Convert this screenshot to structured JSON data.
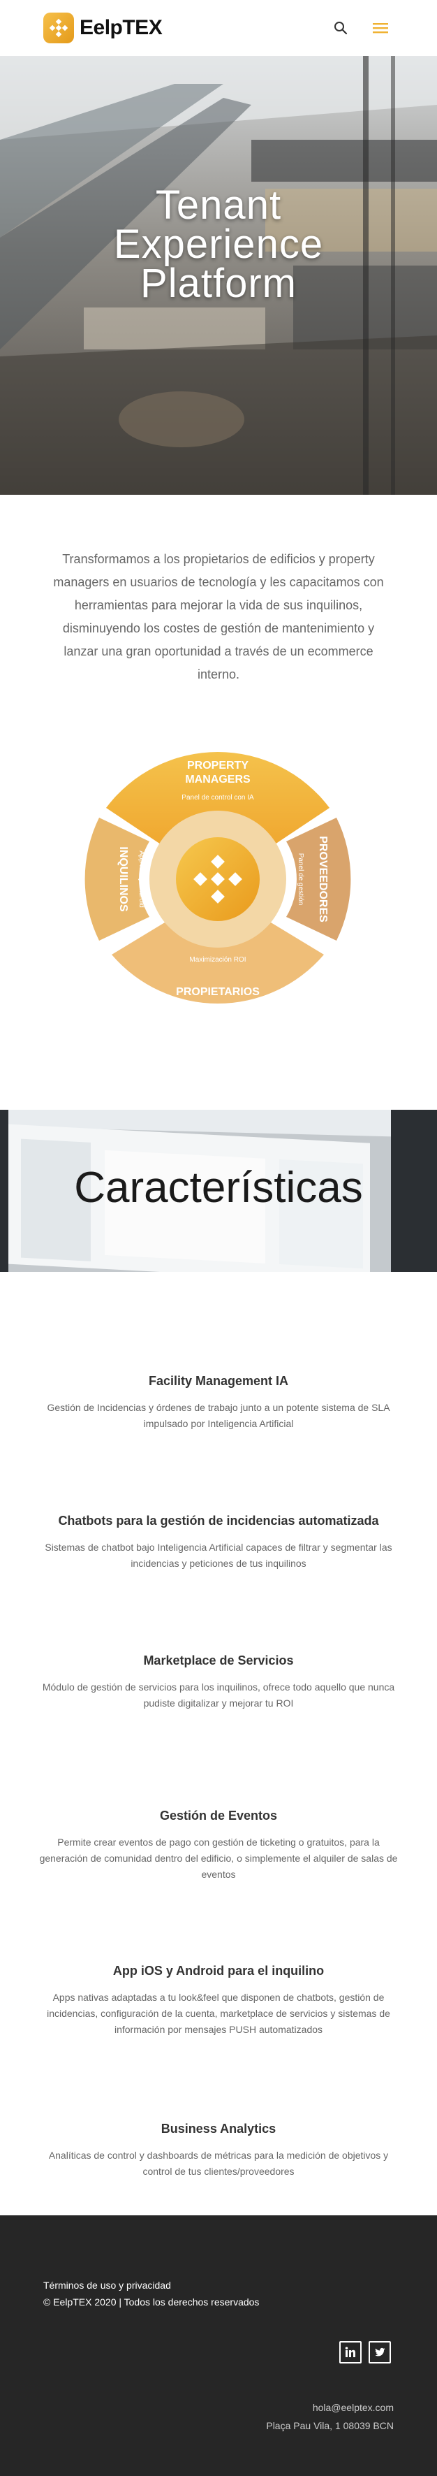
{
  "header": {
    "brand": "EelpTEX",
    "search_icon": "search-icon",
    "menu_icon": "hamburger-menu-icon",
    "accent_color": "#f0b232"
  },
  "hero": {
    "title_line1": "Tenant",
    "title_line2": "Experience",
    "title_line3": "Platform"
  },
  "intro": {
    "text": "Transformamos a los propietarios de edificios y property managers en usuarios de tecnología y les capacitamos con herramientas para mejorar la vida de sus inquilinos, disminuyendo los costes de gestión de mantenimiento y lanzar una gran oportunidad a través de un ecommerce interno."
  },
  "diagram": {
    "top_title_1": "PROPERTY",
    "top_title_2": "MANAGERS",
    "top_sub": "Panel de control con IA",
    "right_title": "PROVEEDORES",
    "right_sub": "Panel de gestión",
    "bottom_title": "PROPIETARIOS",
    "bottom_sub": "Maximización ROI",
    "left_title": "INQUILINOS",
    "left_sub": "App iOS y Android"
  },
  "features": {
    "title": "Características",
    "items": [
      {
        "title": "Facility Management IA",
        "text": "Gestión de Incidencias y órdenes de trabajo junto a un potente sistema de SLA impulsado por Inteligencia Artificial"
      },
      {
        "title": "Chatbots para la gestión de incidencias automatizada",
        "text": "Sistemas de chatbot bajo Inteligencia Artificial capaces de filtrar y segmentar las incidencias y peticiones de tus inquilinos"
      },
      {
        "title": "Marketplace de Servicios",
        "text": "Módulo de gestión de servicios para los inquilinos, ofrece todo aquello que nunca pudiste digitalizar y mejorar tu ROI"
      },
      {
        "title": "Gestión de Eventos",
        "text": "Permite crear eventos de pago con gestión de ticketing o gratuitos, para la generación de comunidad dentro del edificio, o simplemente el alquiler de salas de eventos"
      },
      {
        "title": "App iOS y Android para el inquilino",
        "text": "Apps nativas adaptadas a tu look&feel que disponen de chatbots, gestión de incidencias, configuración de la cuenta, marketplace de servicios y sistemas de información por mensajes PUSH automatizados"
      },
      {
        "title": "Business Analytics",
        "text": "Analíticas de control y dashboards de métricas para la medición de objetivos y control de tus clientes/proveedores"
      }
    ]
  },
  "footer": {
    "terms": "Términos de uso y privacidad",
    "copyright": "© EelpTEX 2020  |  Todos los derechos reservados",
    "social": [
      "linkedin-icon",
      "twitter-icon"
    ],
    "email": "hola@eelptex.com",
    "address": "Plaça Pau Vila, 1 08039 BCN"
  }
}
